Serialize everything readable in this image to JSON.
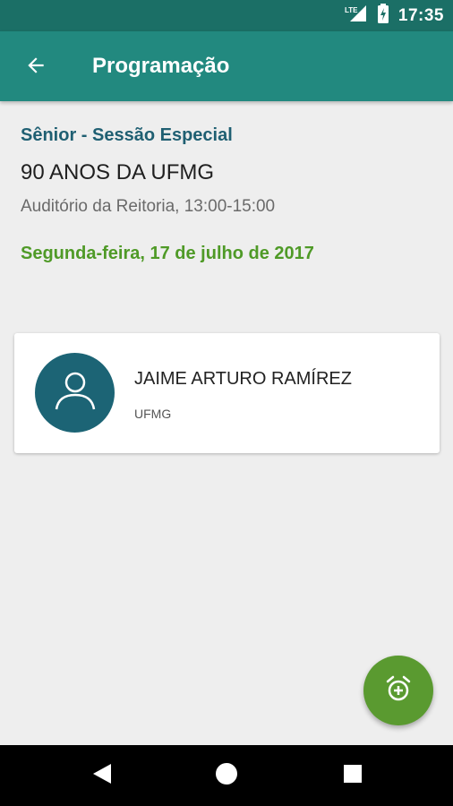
{
  "status_bar": {
    "network_label": "LTE",
    "time": "17:35",
    "icons": [
      "lte-signal-icon",
      "battery-charging-icon"
    ]
  },
  "app_bar": {
    "title": "Programação",
    "back_icon": "arrow-back-icon"
  },
  "event": {
    "category": "Sênior - Sessão Especial",
    "title": "90 ANOS DA UFMG",
    "location_time": "Auditório da Reitoria, 13:00-15:00",
    "date": "Segunda-feira, 17 de julho de 2017"
  },
  "speakers": [
    {
      "name": "JAIME ARTURO RAMÍREZ",
      "organization": "UFMG",
      "avatar_icon": "person-icon"
    }
  ],
  "fab": {
    "icon": "alarm-add-icon"
  },
  "nav_bar": {
    "icons": [
      "back-triangle-icon",
      "home-circle-icon",
      "recents-square-icon"
    ]
  },
  "colors": {
    "status_bar": "#1b6f66",
    "app_bar": "#22897f",
    "category": "#1f5f72",
    "date": "#4f9a27",
    "avatar": "#1c6475",
    "fab": "#5a9a30"
  }
}
